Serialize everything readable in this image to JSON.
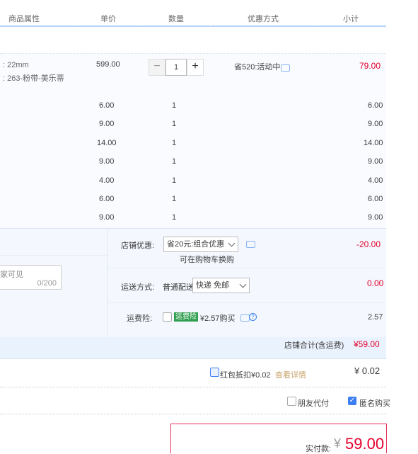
{
  "header": {
    "col_attr": "商品属性",
    "col_price": "单价",
    "col_qty": "数量",
    "col_promo": "优惠方式",
    "col_subtotal": "小计"
  },
  "main_item": {
    "attr_line1": ": 22mm",
    "attr_line2": ": 263-粉带-美乐蒂",
    "price": "599.00",
    "qty": "1",
    "minus": "−",
    "plus": "+",
    "promo": "省520:活动中",
    "subtotal": "79.00"
  },
  "extra_items": [
    {
      "price": "6.00",
      "qty": "1",
      "subtotal": "6.00"
    },
    {
      "price": "9.00",
      "qty": "1",
      "subtotal": "9.00"
    },
    {
      "price": "14.00",
      "qty": "1",
      "subtotal": "14.00"
    },
    {
      "price": "9.00",
      "qty": "1",
      "subtotal": "9.00"
    },
    {
      "price": "4.00",
      "qty": "1",
      "subtotal": "4.00"
    },
    {
      "price": "6.00",
      "qty": "1",
      "subtotal": "6.00"
    },
    {
      "price": "9.00",
      "qty": "1",
      "subtotal": "9.00"
    }
  ],
  "message": {
    "text_partial": "家可见",
    "counter": "0/200"
  },
  "shop_discount": {
    "label": "店铺优惠:",
    "selected": "省20元:组合优惠",
    "note": "可在购物车换购",
    "amount": "-20.00"
  },
  "shipping": {
    "label": "运送方式:",
    "method": "普通配送",
    "selected": "快递 免邮",
    "amount": "0.00"
  },
  "insurance": {
    "label": "运费险:",
    "tag": "运费险",
    "price_text": "¥2.57购买",
    "amount": "2.57"
  },
  "shop_total": {
    "label": "店铺合计(含运费)",
    "amount": "¥59.00"
  },
  "redpacket": {
    "label": "红包抵扣¥0.02",
    "link": "查看详情",
    "amount": "¥ 0.02"
  },
  "options": {
    "friend_pay": "朋友代付",
    "anonymous": "匿名购买"
  },
  "pay": {
    "label": "实付款:",
    "currency": "¥",
    "amount": "59.00"
  },
  "colors": {
    "accent": "#3d7ef2",
    "price_red": "#e4002b",
    "header_line": "#b2d1ff"
  }
}
